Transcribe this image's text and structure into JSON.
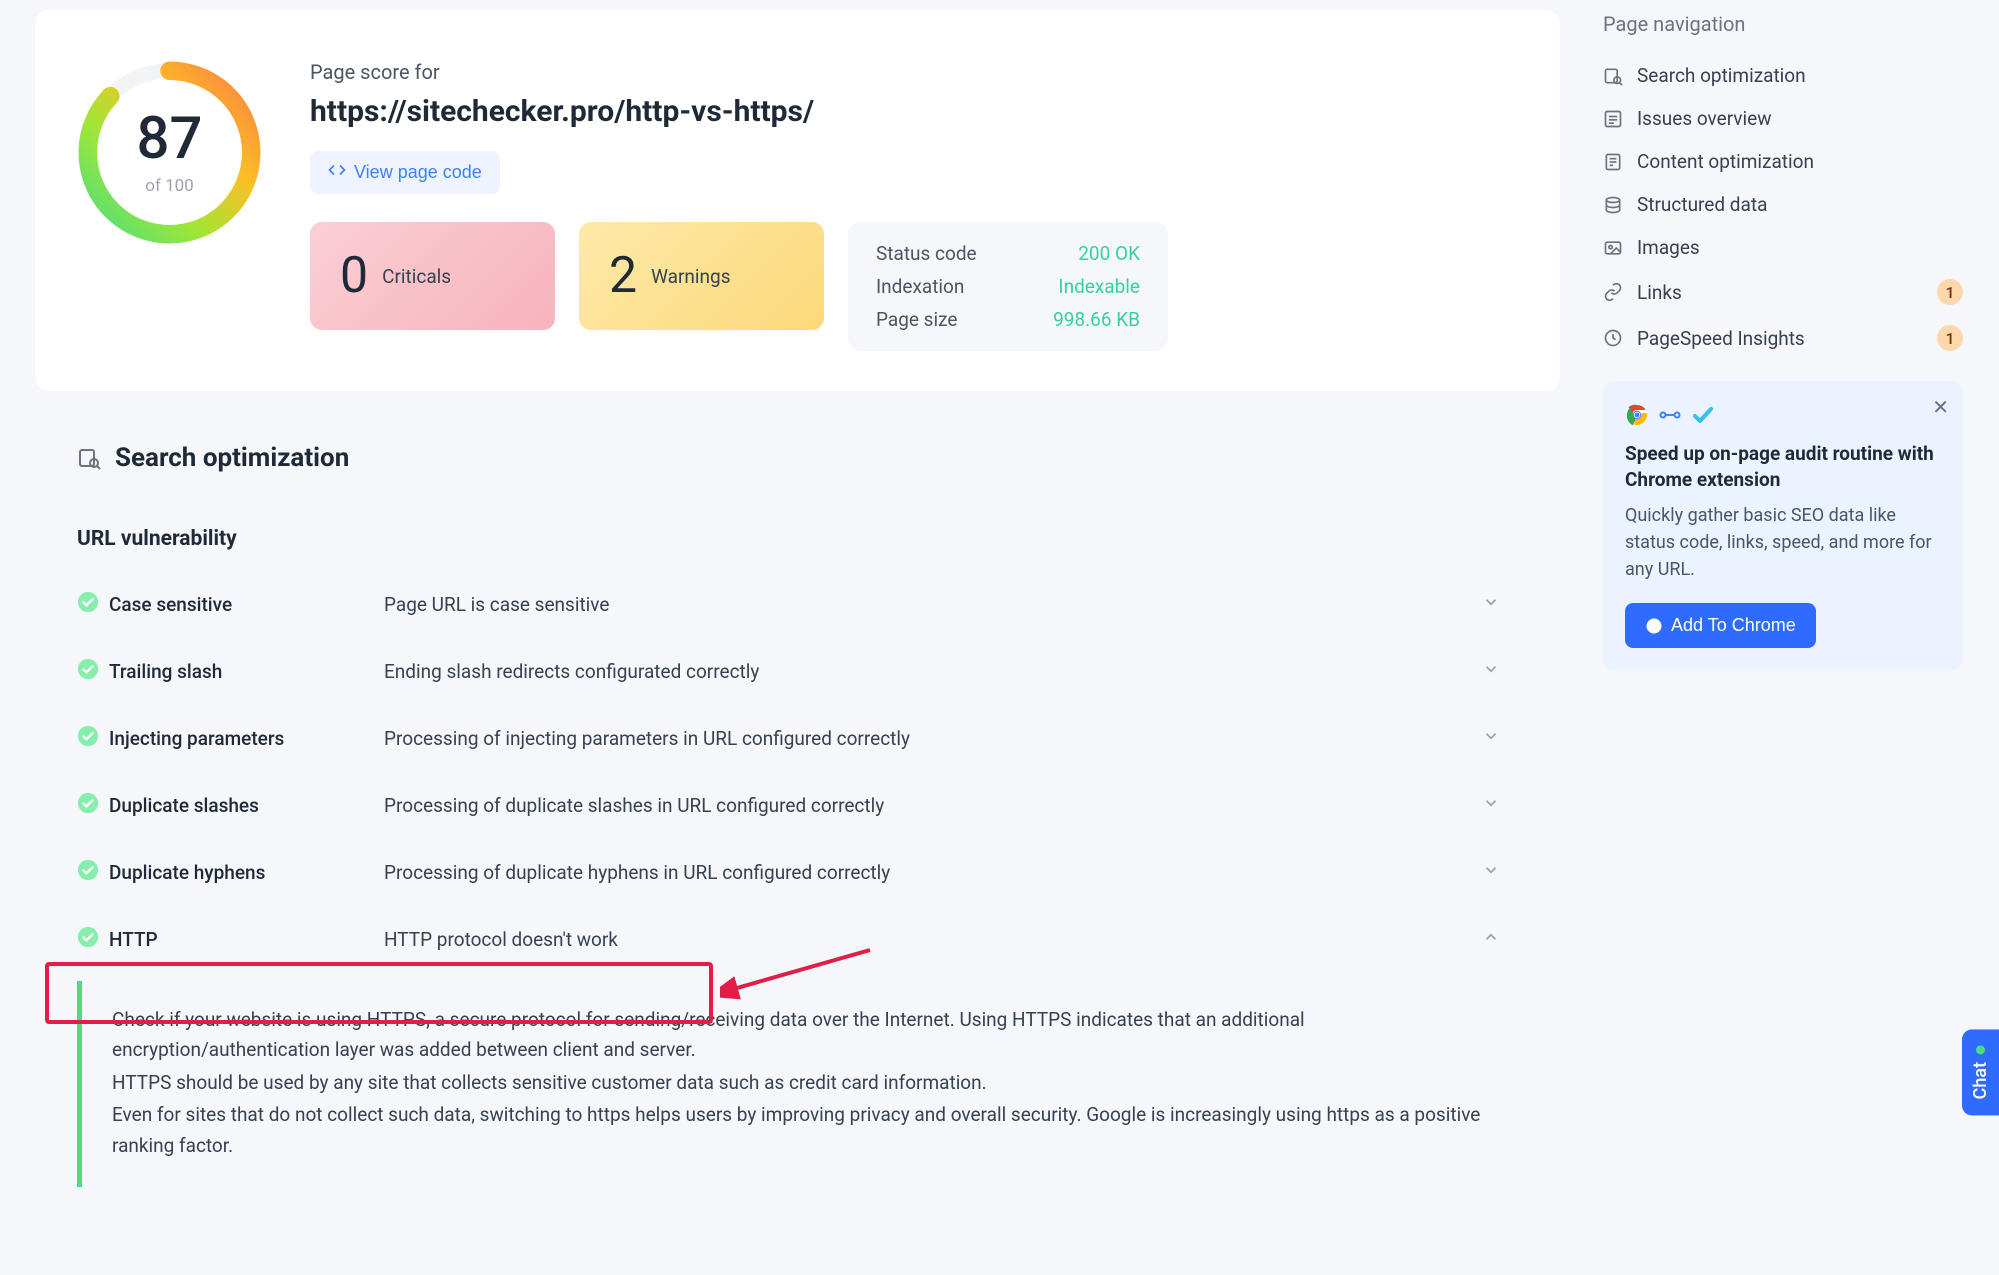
{
  "score": {
    "value": "87",
    "of": "of 100"
  },
  "header": {
    "label": "Page score for",
    "url": "https://sitechecker.pro/http-vs-https/",
    "view_code": "View page code"
  },
  "stats": {
    "criticals": {
      "n": "0",
      "label": "Criticals"
    },
    "warnings": {
      "n": "2",
      "label": "Warnings"
    },
    "info": {
      "status_k": "Status code",
      "status_v": "200 OK",
      "index_k": "Indexation",
      "index_v": "Indexable",
      "size_k": "Page size",
      "size_v": "998.66 KB"
    }
  },
  "section": {
    "title": "Search optimization"
  },
  "subsection": "URL vulnerability",
  "checks": [
    {
      "name": "Case sensitive",
      "desc": "Page URL is case sensitive",
      "open": false
    },
    {
      "name": "Trailing slash",
      "desc": "Ending slash redirects configurated correctly",
      "open": false
    },
    {
      "name": "Injecting parameters",
      "desc": "Processing of injecting parameters in URL configured correctly",
      "open": false
    },
    {
      "name": "Duplicate slashes",
      "desc": "Processing of duplicate slashes in URL configured correctly",
      "open": false
    },
    {
      "name": "Duplicate hyphens",
      "desc": "Processing of duplicate hyphens in URL configured correctly",
      "open": false
    },
    {
      "name": "HTTP",
      "desc": "HTTP protocol doesn't work",
      "open": true
    }
  ],
  "expanded": {
    "p1": "Check if your website is using HTTPS, a secure protocol for sending/receiving data over the Internet. Using HTTPS indicates that an additional encryption/authentication layer was added between client and server.",
    "p2": "HTTPS should be used by any site that collects sensitive customer data such as credit card information.",
    "p3": "Even for sites that do not collect such data, switching to https helps users by improving privacy and overall security. Google is increasingly using https as a positive ranking factor."
  },
  "sidebar": {
    "title": "Page navigation",
    "items": [
      {
        "label": "Search optimization",
        "badge": ""
      },
      {
        "label": "Issues overview",
        "badge": ""
      },
      {
        "label": "Content optimization",
        "badge": ""
      },
      {
        "label": "Structured data",
        "badge": ""
      },
      {
        "label": "Images",
        "badge": ""
      },
      {
        "label": "Links",
        "badge": "1"
      },
      {
        "label": "PageSpeed Insights",
        "badge": "1"
      }
    ]
  },
  "promo": {
    "title": "Speed up on-page audit routine with Chrome extension",
    "text": "Quickly gather basic SEO data like status code, links, speed, and more for any URL.",
    "btn": "Add To Chrome"
  },
  "chat": "Chat",
  "colors": {
    "green": "#4ade80",
    "green_text": "#34d399",
    "blue": "#2f6bff",
    "red": "#e11d48"
  }
}
